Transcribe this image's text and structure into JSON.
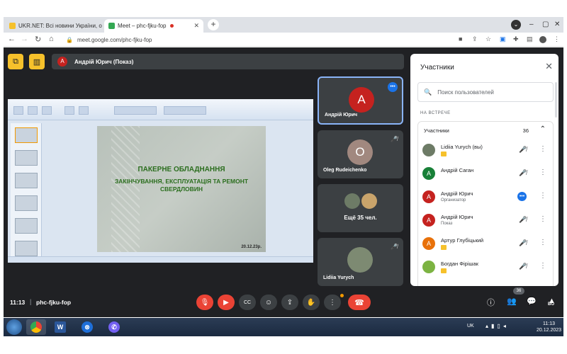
{
  "browser": {
    "tabs": [
      {
        "label": "UKR.NET: Всі новини України, о",
        "active": false,
        "favicon_color": "#f6c12b"
      },
      {
        "label": "Meet – phc-fjku-fop",
        "active": true,
        "favicon_color": "#34a853"
      }
    ],
    "new_tab_label": "+",
    "url": "meet.google.com/phc-fjku-fop"
  },
  "meet": {
    "presenter_initial": "А",
    "presenter_label": "Андрій Юрич (Показ)",
    "slide": {
      "title": "ПАКЕРНЕ ОБЛАДНАННЯ",
      "subtitle": "ЗАКІНЧУВАННЯ, ЕКСПЛУАТАЦІЯ ТА РЕМОНТ СВЕРДЛОВИН",
      "date": "20.12.23р."
    },
    "tiles": [
      {
        "initial": "А",
        "name": "Андрій Юрич",
        "avatar_color": "#c5221f"
      },
      {
        "initial": "O",
        "name": "Oleg Rudeichenko",
        "avatar_color": "#a1887f"
      },
      {
        "more_label": "Ещё 35 чел."
      },
      {
        "name": "Lidiia Yurych"
      }
    ],
    "time": "11:13",
    "separator": "|",
    "meeting_code": "phc-fjku-fop",
    "people_count": "36",
    "breakout_label": "BO"
  },
  "panel": {
    "title": "Участники",
    "search_placeholder": "Поиск пользователей",
    "section_label": "НА ВСТРЕЧЕ",
    "group_label": "Участники",
    "group_count": "36",
    "participants": [
      {
        "name": "Lidiia Yurych (вы)",
        "initial": "",
        "avatar_color": "#6d7b66",
        "badge": true,
        "role": ""
      },
      {
        "name": "Андрій Саган",
        "initial": "А",
        "avatar_color": "#188038",
        "badge": false,
        "role": ""
      },
      {
        "name": "Андрій Юрич",
        "initial": "А",
        "avatar_color": "#c5221f",
        "badge": false,
        "role": "Организатор"
      },
      {
        "name": "Андрій Юрич",
        "initial": "А",
        "avatar_color": "#c5221f",
        "badge": false,
        "role": "Показ"
      },
      {
        "name": "Артур Глубіцький",
        "initial": "А",
        "avatar_color": "#e8710a",
        "badge": true,
        "role": ""
      },
      {
        "name": "Богдан Фірішак",
        "initial": "",
        "avatar_color": "#7cb342",
        "badge": true,
        "role": ""
      }
    ]
  },
  "taskbar": {
    "lang": "UK",
    "clock_time": "11:13",
    "clock_date": "20.12.2023"
  }
}
